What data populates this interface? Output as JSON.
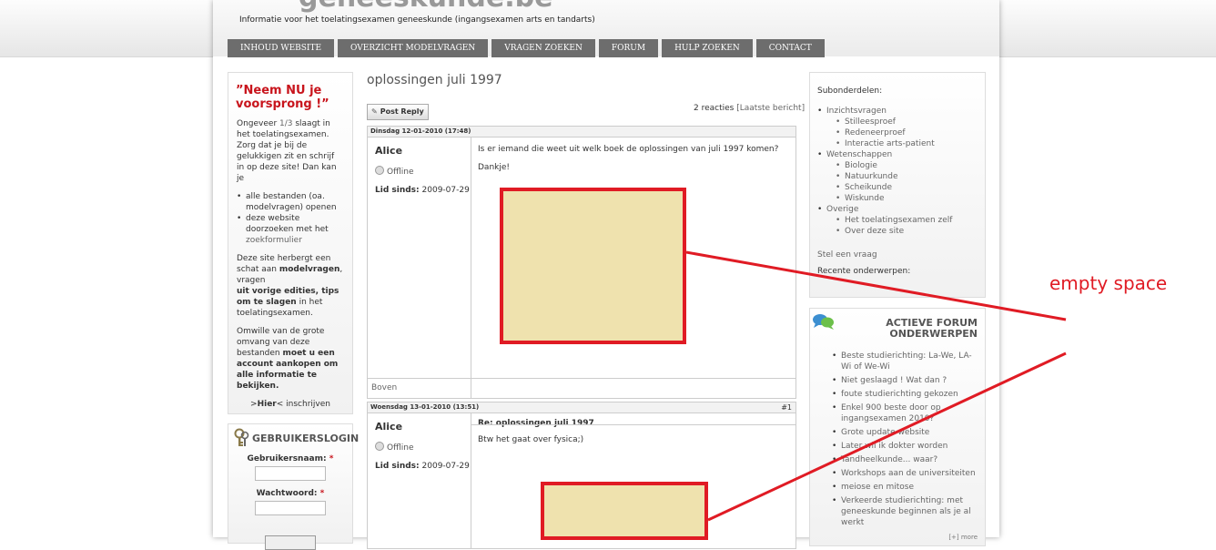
{
  "site": {
    "title": "geneeskunde.be",
    "tagline": "Informatie voor het toelatingsexamen geneeskunde (ingangsexamen arts en tandarts)"
  },
  "nav": [
    "INHOUD WEBSITE",
    "OVERZICHT MODELVRAGEN",
    "VRAGEN ZOEKEN",
    "FORUM",
    "HULP ZOEKEN",
    "CONTACT"
  ],
  "promo": {
    "title": "”Neem NU je voorsprong !”",
    "p1_a": "Ongeveer ",
    "p1_link": "1/3",
    "p1_b": " slaagt in het toelatingsexamen. Zorg dat je bij de gelukkigen zit en schrijf in op deze site! Dan kan je",
    "items": [
      {
        "text": "alle bestanden (oa. modelvragen) openen",
        "link": ""
      },
      {
        "text": "deze website doorzoeken met het ",
        "link": "zoekformulier"
      }
    ],
    "p2_a": "Deze site herbergt een schat aan ",
    "p2_b": "modelvragen",
    "p2_c": ", vragen",
    "p2_d": "uit vorige edities, tips om te slagen",
    "p2_e": " in het toelatingsexamen.",
    "p3_a": "Omwille van de grote omvang van deze bestanden ",
    "p3_b": "moet u een account aankopen om alle informatie te bekijken.",
    "signup_a": ">",
    "signup_b": "Hier",
    "signup_c": "< inschrijven"
  },
  "login": {
    "title": "GEBRUIKERSLOGIN",
    "username_label": "Gebruikersnaam:",
    "password_label": "Wachtwoord:",
    "required": "*"
  },
  "thread": {
    "title": "oplossingen juli 1997",
    "post_reply": "Post Reply",
    "replies": "2 reacties",
    "last_post": "[Laatste bericht]",
    "top_link": "Boven"
  },
  "posts": [
    {
      "date": "Dinsdag 12-01-2010 (17:48)",
      "number": "",
      "author": "Alice",
      "status": "Offline",
      "since_label": "Lid sinds:",
      "since": "2009-07-29",
      "subject": "",
      "body": [
        "Is er iemand die weet uit welk boek de oplossingen van juli 1997 komen?",
        "Dankje!"
      ]
    },
    {
      "date": "Woensdag 13-01-2010 (13:51)",
      "number": "#1",
      "author": "Alice",
      "status": "Offline",
      "since_label": "Lid sinds:",
      "since": "2009-07-29",
      "subject": "Re: oplossingen juli 1997",
      "body": [
        "Btw het gaat over fysica;)"
      ]
    }
  ],
  "sidebar": {
    "subheading": "Subonderdelen:",
    "groups": [
      {
        "label": "Inzichtsvragen",
        "items": [
          "Stilleesproef",
          "Redeneerproef",
          "Interactie arts-patient"
        ]
      },
      {
        "label": "Wetenschappen",
        "items": [
          "Biologie",
          "Natuurkunde",
          "Scheikunde",
          "Wiskunde"
        ]
      },
      {
        "label": "Overige",
        "items": [
          "Het toelatingsexamen zelf",
          "Over deze site"
        ]
      }
    ],
    "ask": "Stel een vraag",
    "recent": "Recente onderwerpen:"
  },
  "forum": {
    "title": "ACTIEVE FORUM ONDERWERPEN",
    "items": [
      "Beste studierichting: La-We, LA-Wi of We-Wi",
      "Niet geslaagd ! Wat dan ?",
      "foute studierichting gekozen",
      "Enkel 900 beste door op ingangsexamen 2010?",
      "Grote update website",
      "Later wil ik dokter worden",
      "Tandheelkunde... waar?",
      "Workshops aan de universiteiten",
      "meiose en mitose",
      "Verkeerde studierichting: met geneeskunde beginnen als je al werkt"
    ],
    "more": "[+] more"
  },
  "annotation": {
    "label": "empty space",
    "color": "#e01b24"
  }
}
